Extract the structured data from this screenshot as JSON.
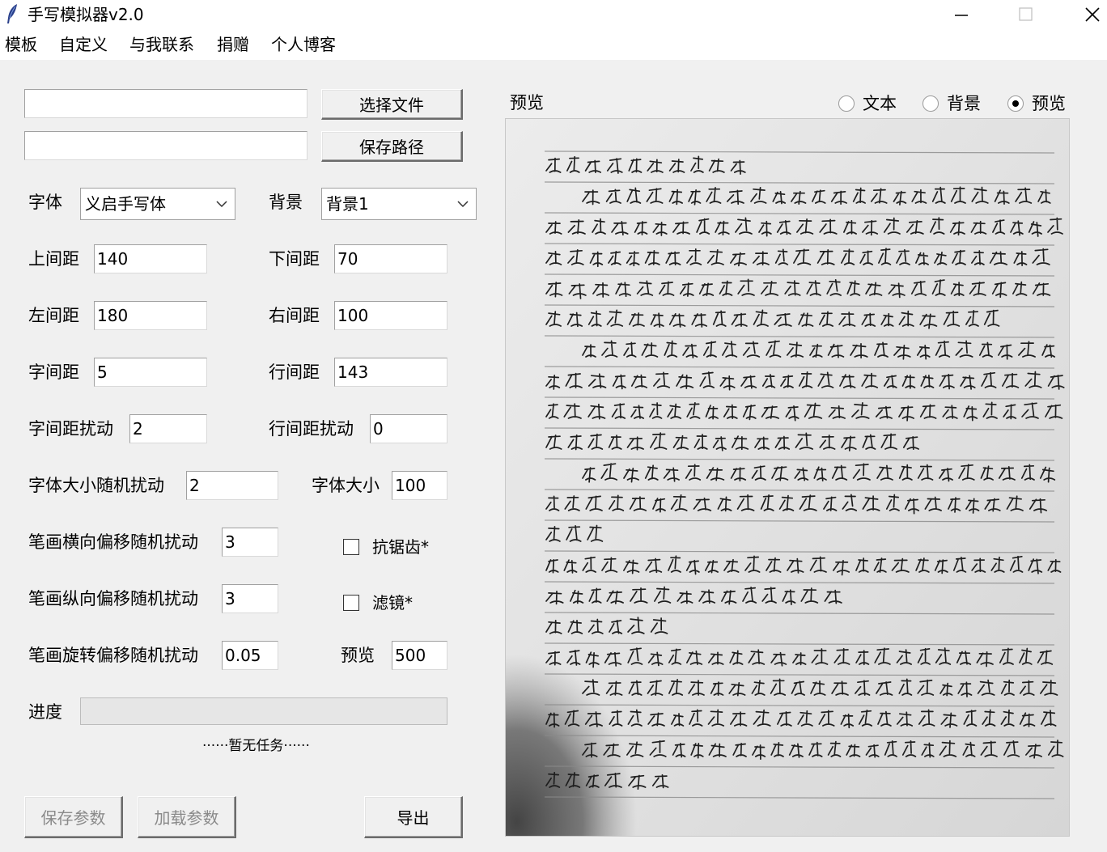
{
  "window": {
    "title": "手写模拟器v2.0"
  },
  "menu": [
    "模板",
    "自定义",
    "与我联系",
    "捐赠",
    "个人博客"
  ],
  "file": {
    "input_path": "",
    "output_path": "",
    "choose_file_label": "选择文件",
    "save_path_label": "保存路径"
  },
  "font": {
    "label": "字体",
    "selected": "义启手写体"
  },
  "background": {
    "label": "背景",
    "selected": "背景1"
  },
  "params": {
    "top_margin": {
      "label": "上间距",
      "value": "140"
    },
    "bottom_margin": {
      "label": "下间距",
      "value": "70"
    },
    "left_margin": {
      "label": "左间距",
      "value": "180"
    },
    "right_margin": {
      "label": "右间距",
      "value": "100"
    },
    "char_spacing": {
      "label": "字间距",
      "value": "5"
    },
    "line_spacing": {
      "label": "行间距",
      "value": "143"
    },
    "char_spacing_jitter": {
      "label": "字间距扰动",
      "value": "2"
    },
    "line_spacing_jitter": {
      "label": "行间距扰动",
      "value": "0"
    },
    "font_size_jitter": {
      "label": "字体大小随机扰动",
      "value": "2"
    },
    "font_size": {
      "label": "字体大小",
      "value": "100"
    },
    "stroke_h_jitter": {
      "label": "笔画横向偏移随机扰动",
      "value": "3"
    },
    "stroke_v_jitter": {
      "label": "笔画纵向偏移随机扰动",
      "value": "3"
    },
    "stroke_rot_jitter": {
      "label": "笔画旋转偏移随机扰动",
      "value": "0.05"
    },
    "preview_size": {
      "label": "预览",
      "value": "500"
    }
  },
  "options": {
    "antialias_label": "抗锯齿*",
    "filter_label": "滤镜*"
  },
  "progress": {
    "label": "进度",
    "status": "······暂无任务······",
    "fraction": 0
  },
  "buttons": {
    "save_params": "保存参数",
    "load_params": "加载参数",
    "export": "导出"
  },
  "preview": {
    "label": "预览",
    "modes": [
      {
        "label": "文本",
        "selected": false
      },
      {
        "label": "背景",
        "selected": false
      },
      {
        "label": "预览",
        "selected": true
      }
    ]
  }
}
